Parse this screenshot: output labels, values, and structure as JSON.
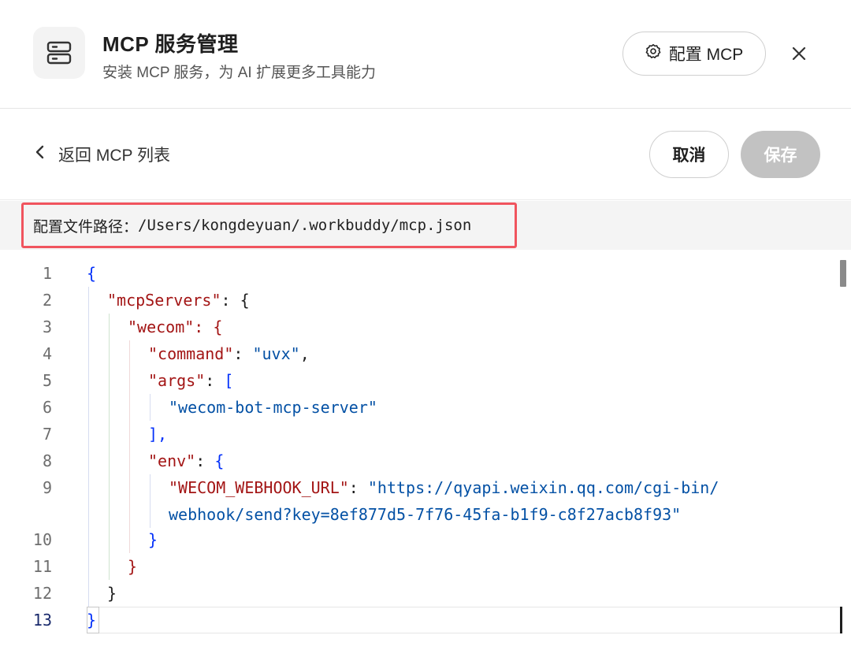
{
  "header": {
    "title": "MCP 服务管理",
    "subtitle": "安装 MCP 服务，为 AI 扩展更多工具能力",
    "config_button_label": "配置 MCP",
    "app_icon": "server-icon",
    "config_icon": "gear-icon",
    "close_icon": "close-icon"
  },
  "toolbar": {
    "back_label": "返回 MCP 列表",
    "back_icon": "chevron-left-icon",
    "cancel_label": "取消",
    "save_label": "保存"
  },
  "path": {
    "label": "配置文件路径：",
    "value": "/Users/kongdeyuan/.workbuddy/mcp.json"
  },
  "editor": {
    "line_numbers": [
      "1",
      "2",
      "3",
      "4",
      "5",
      "6",
      "7",
      "8",
      "9",
      "10",
      "11",
      "12",
      "13"
    ],
    "active_line": "13",
    "code": {
      "l1": "{",
      "l2_key": "\"mcpServers\"",
      "l2_rest": ": {",
      "l3_key": "\"wecom\"",
      "l3_rest": ": {",
      "l4_key": "\"command\"",
      "l4_colon": ": ",
      "l4_val": "\"uvx\"",
      "l4_end": ",",
      "l5_key": "\"args\"",
      "l5_colon": ": ",
      "l5_bracket": "[",
      "l6_val": "\"wecom-bot-mcp-server\"",
      "l7": "],",
      "l8_key": "\"env\"",
      "l8_colon": ": ",
      "l8_brace": "{",
      "l9_key": "\"WECOM_WEBHOOK_URL\"",
      "l9_colon": ": ",
      "l9_val_a": "\"https://qyapi.weixin.qq.com/cgi-bin/",
      "l9_val_b": "webhook/send?key=8ef877d5-7f76-45fa-b1f9-c8f27acb8f93\"",
      "l10": "}",
      "l11": "}",
      "l12": "}",
      "l13": "}"
    }
  },
  "colors": {
    "key": "#a31515",
    "string": "#0451a5",
    "bracket": "#0431fa",
    "highlight_border": "#f0545e",
    "save_disabled": "#c2c2c2"
  }
}
